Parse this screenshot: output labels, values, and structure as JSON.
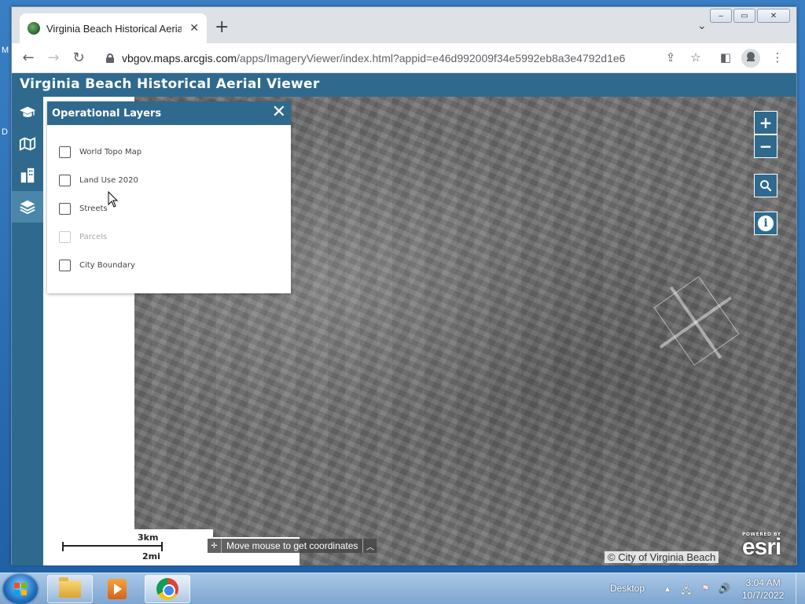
{
  "browser": {
    "tab_title": "Virginia Beach Historical Aerial V",
    "tab_close": "✕",
    "new_tab": "+",
    "url_host": "vbgov.maps.arcgis.com",
    "url_path": "/apps/ImageryViewer/index.html?appid=e46d992009f34e5992eb8a3e4792d1e6",
    "window_buttons": [
      "‒",
      "▭",
      "✕"
    ]
  },
  "app": {
    "title": "Virginia Beach Historical Aerial Viewer",
    "sidebar_items": [
      {
        "icon": "graduation-cap-icon"
      },
      {
        "icon": "map-icon"
      },
      {
        "icon": "buildings-icon"
      },
      {
        "icon": "layers-icon",
        "active": true
      }
    ]
  },
  "layers_panel": {
    "title": "Operational Layers",
    "close": "✕",
    "layers": [
      {
        "label": "World Topo Map",
        "checked": false,
        "disabled": false
      },
      {
        "label": "Land Use 2020",
        "checked": false,
        "disabled": false
      },
      {
        "label": "Streets",
        "checked": false,
        "disabled": false
      },
      {
        "label": "Parcels",
        "checked": false,
        "disabled": true
      },
      {
        "label": "City Boundary",
        "checked": false,
        "disabled": false
      }
    ]
  },
  "map_controls": {
    "zoom_in": "+",
    "zoom_out": "−",
    "info": "i"
  },
  "scalebar": {
    "km": "3km",
    "mi": "2mi"
  },
  "coordinates": {
    "text": "Move mouse to get coordinates"
  },
  "attribution": "© City of Virginia Beach",
  "esri": {
    "powered": "POWERED BY",
    "word": "esri"
  },
  "taskbar": {
    "desktop_label": "Desktop",
    "time": "3:04 AM",
    "date": "10/7/2022"
  },
  "desktop_letters": [
    "M",
    "D"
  ]
}
